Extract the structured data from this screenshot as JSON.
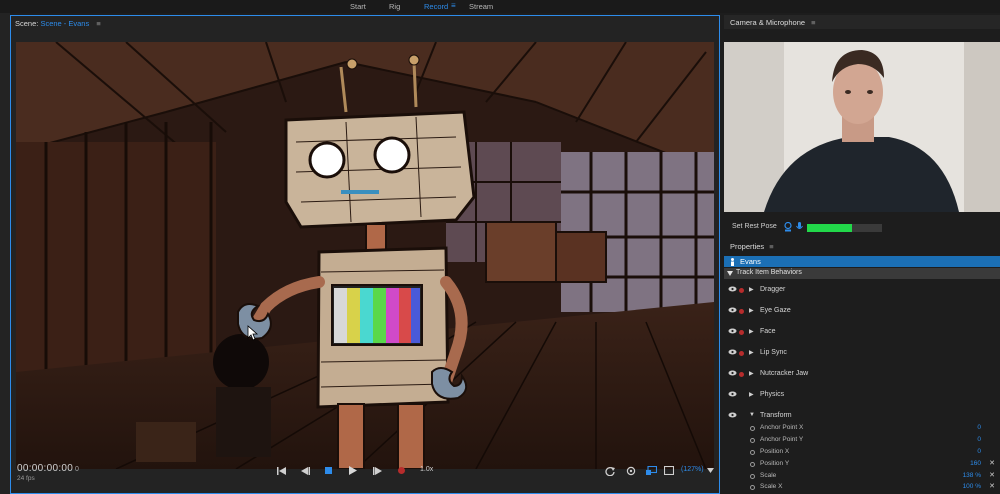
{
  "workspaces": [
    "Start",
    "Rig",
    "Record",
    "Stream"
  ],
  "active_workspace": "Record",
  "workspace_menu_glyph": "≡",
  "scene_panel": {
    "label": "Scene:",
    "scene_name": "Scene - Evans",
    "timecode": "00:00:00:00",
    "frame": "0",
    "fps": "24 fps",
    "playback_rate": "1.0x",
    "zoom": "(127%)"
  },
  "camera_panel": {
    "title": "Camera & Microphone",
    "set_rest_pose": "Set Rest Pose",
    "mic_level": 0.6
  },
  "properties": {
    "title": "Properties",
    "puppet": "Evans",
    "section": "Track Item Behaviors",
    "behaviors": [
      "Dragger",
      "Eye Gaze",
      "Face",
      "Lip Sync",
      "Nutcracker Jaw",
      "Physics",
      "Transform"
    ],
    "params": [
      {
        "name": "Anchor Point X",
        "value": "0"
      },
      {
        "name": "Anchor Point Y",
        "value": "0"
      },
      {
        "name": "Position X",
        "value": "0"
      },
      {
        "name": "Position Y",
        "value": "160"
      },
      {
        "name": "Scale",
        "value": "138 %"
      },
      {
        "name": "Scale X",
        "value": "100 %"
      }
    ]
  },
  "colors": {
    "accent": "#2d8ceb",
    "selection": "#1b6fb5",
    "record": "#b72c2c",
    "meter": "#22d84a"
  }
}
